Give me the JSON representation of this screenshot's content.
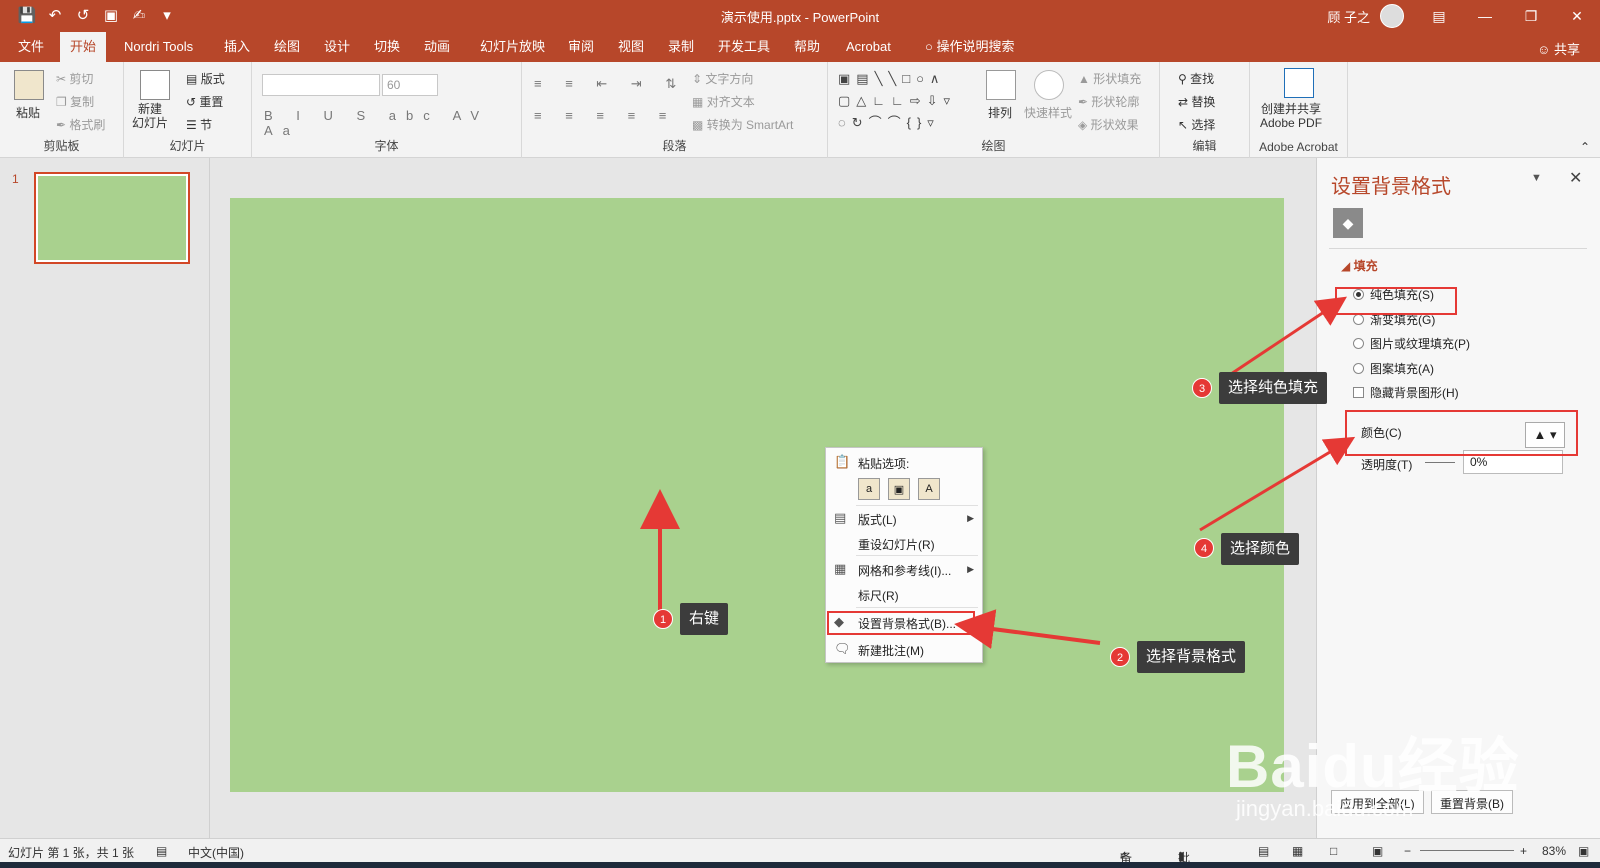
{
  "window": {
    "title": "演示使用.pptx  -  PowerPoint",
    "user": "顾 子之",
    "qat_icons": [
      "save-icon",
      "undo-icon",
      "redo-icon",
      "present-icon",
      "touch-icon",
      "customize-icon"
    ]
  },
  "tabs": [
    "文件",
    "开始",
    "Nordri Tools",
    "插入",
    "绘图",
    "设计",
    "切换",
    "动画",
    "幻灯片放映",
    "审阅",
    "视图",
    "录制",
    "开发工具",
    "帮助",
    "Acrobat",
    "操作说明搜索"
  ],
  "active_tab": "开始",
  "share": "共享",
  "ribbon": {
    "clipboard": {
      "name": "剪贴板",
      "paste": "粘贴",
      "cut": "剪切",
      "copy": "复制",
      "format_painter": "格式刷"
    },
    "slides": {
      "name": "幻灯片",
      "new_slide": "新建\n幻灯片",
      "layout": "版式",
      "reset": "重置",
      "section": "节"
    },
    "font": {
      "name": "字体",
      "size": "60"
    },
    "paragraph": {
      "name": "段落",
      "text_direction": "文字方向",
      "align_text": "对齐文本",
      "smartart": "转换为 SmartArt"
    },
    "drawing": {
      "name": "绘图",
      "arrange": "排列",
      "quick_styles": "快速样式",
      "shape_fill": "形状填充",
      "shape_outline": "形状轮廓",
      "shape_effects": "形状效果"
    },
    "editing": {
      "name": "编辑",
      "find": "查找",
      "replace": "替换",
      "select": "选择"
    },
    "acrobat": {
      "name": "Adobe Acrobat",
      "create": "创建并共享\nAdobe PDF"
    }
  },
  "thumbnails": {
    "number": "1"
  },
  "context_menu": {
    "paste_options": "粘贴选项:",
    "items": [
      "版式(L)",
      "重设幻灯片(R)",
      "网格和参考线(I)...",
      "标尺(R)",
      "设置背景格式(B)...",
      "新建批注(M)"
    ]
  },
  "format_pane": {
    "title": "设置背景格式",
    "section": "填充",
    "options": [
      "纯色填充(S)",
      "渐变填充(G)",
      "图片或纹理填充(P)",
      "图案填充(A)"
    ],
    "selected": "纯色填充(S)",
    "hide_bg": "隐藏背景图形(H)",
    "color_label": "颜色(C)",
    "transparency_label": "透明度(T)",
    "transparency_value": "0%",
    "apply_all": "应用到全部(L)",
    "reset_bg": "重置背景(B)"
  },
  "callouts": {
    "c1": {
      "num": "1",
      "text": "右键"
    },
    "c2": {
      "num": "2",
      "text": "选择背景格式"
    },
    "c3": {
      "num": "3",
      "text": "选择纯色填充"
    },
    "c4": {
      "num": "4",
      "text": "选择颜色"
    }
  },
  "status": {
    "slide_info": "幻灯片 第 1 张，共 1 张",
    "language": "中文(中国)",
    "notes": "备注",
    "comments": "批注",
    "zoom": "83%"
  },
  "watermark": {
    "logo": "Baidu经验",
    "url": "jingyan.baidu.com"
  },
  "colors": {
    "accent": "#b7472a",
    "slide_bg": "#a9d18e",
    "annotation_red": "#e53935"
  }
}
